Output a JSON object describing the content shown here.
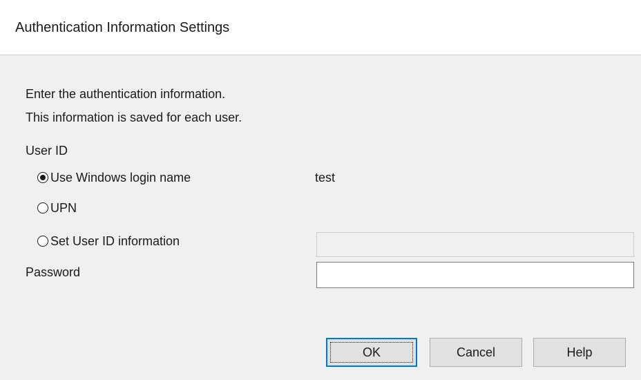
{
  "window": {
    "title": "Authentication Information Settings"
  },
  "instructions": {
    "line1": "Enter the authentication information.",
    "line2": "This information is saved for each user."
  },
  "user_id": {
    "label": "User ID",
    "options": [
      {
        "label": "Use Windows login name",
        "selected": true
      },
      {
        "label": "UPN",
        "selected": false
      },
      {
        "label": "Set User ID information",
        "selected": false
      }
    ],
    "windows_login_value": "test",
    "set_user_id_value": ""
  },
  "password": {
    "label": "Password",
    "value": ""
  },
  "buttons": {
    "ok": "OK",
    "cancel": "Cancel",
    "help": "Help"
  },
  "colors": {
    "focus_border": "#0078d7",
    "window_bg": "#f0f0f0",
    "titlebar_bg": "#ffffff"
  }
}
